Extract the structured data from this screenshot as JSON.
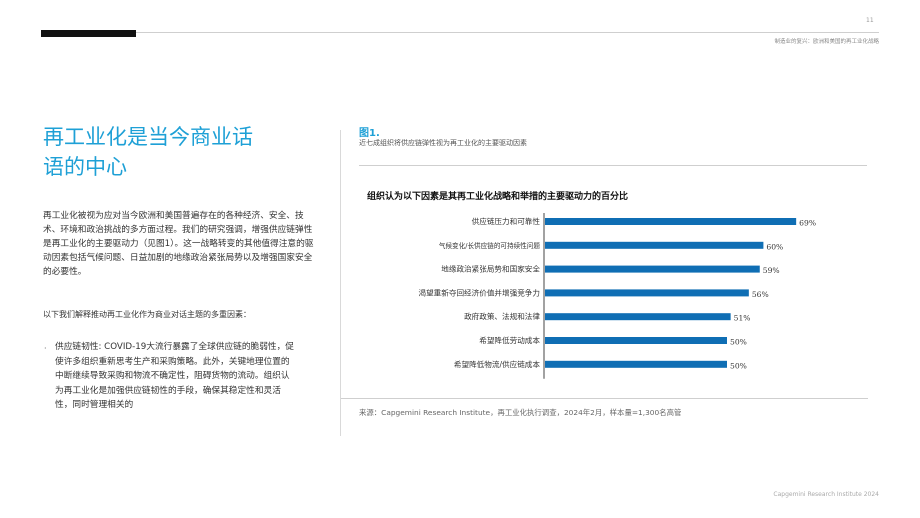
{
  "page": {
    "number": "11",
    "running_head": "制造业的复兴：欧洲和美国的再工业化战略",
    "footer": "Capgemini Research Institute 2024"
  },
  "left": {
    "headline_line1": "再工业化是当今商业话",
    "headline_line2": "语的中心",
    "intro": "再工业化被视为应对当今欧洲和美国普遍存在的各种经济、安全、技术、环境和政治挑战的多方面过程。我们的研究强调，增强供应链弹性是再工业化的主要驱动力（见图1）。这一战略转变的其他值得注意的驱动因素包括气候问题、日益加剧的地缘政治紧张局势以及增强国家安全的必要性。",
    "lead": "以下我们解释推动再工业化作为商业对话主题的多重因素：",
    "bullet_marker": "·",
    "bullet": "供应链韧性: COVID-19大流行暴露了全球供应链的脆弱性，促使许多组织重新思考生产和采购策略。此外，关键地理位置的中断继续导致采购和物流不确定性，阻碍货物的流动。组织认为再工业化是加强供应链韧性的手段，确保其稳定性和灵活性，同时管理相关的"
  },
  "figure": {
    "label": "图1.",
    "subtitle": "近七成组织将供应链弹性视为再工业化的主要驱动因素",
    "source": "来源：Capgemini Research Institute，再工业化执行调查，2024年2月，样本量=1,300名高管"
  },
  "chart_data": {
    "type": "bar",
    "orientation": "horizontal",
    "title": "组织认为以下因素是其再工业化战略和举措的主要驱动力的百分比",
    "categories": [
      "供应链压力和可靠性",
      "气候变化/长供应链的可持续性问题",
      "地缘政治紧张局势和国家安全",
      "渴望重新夺回经济价值并增强竞争力",
      "政府政策、法规和法律",
      "希望降低劳动成本",
      "希望降低物流/供应链成本"
    ],
    "values": [
      69,
      60,
      59,
      56,
      51,
      50,
      50
    ],
    "value_labels": [
      "69%",
      "60%",
      "59%",
      "56%",
      "51%",
      "50%",
      "50%"
    ],
    "unit": "%",
    "xlim": [
      0,
      100
    ],
    "bar_color": "#0f6eb4",
    "grid": false
  }
}
